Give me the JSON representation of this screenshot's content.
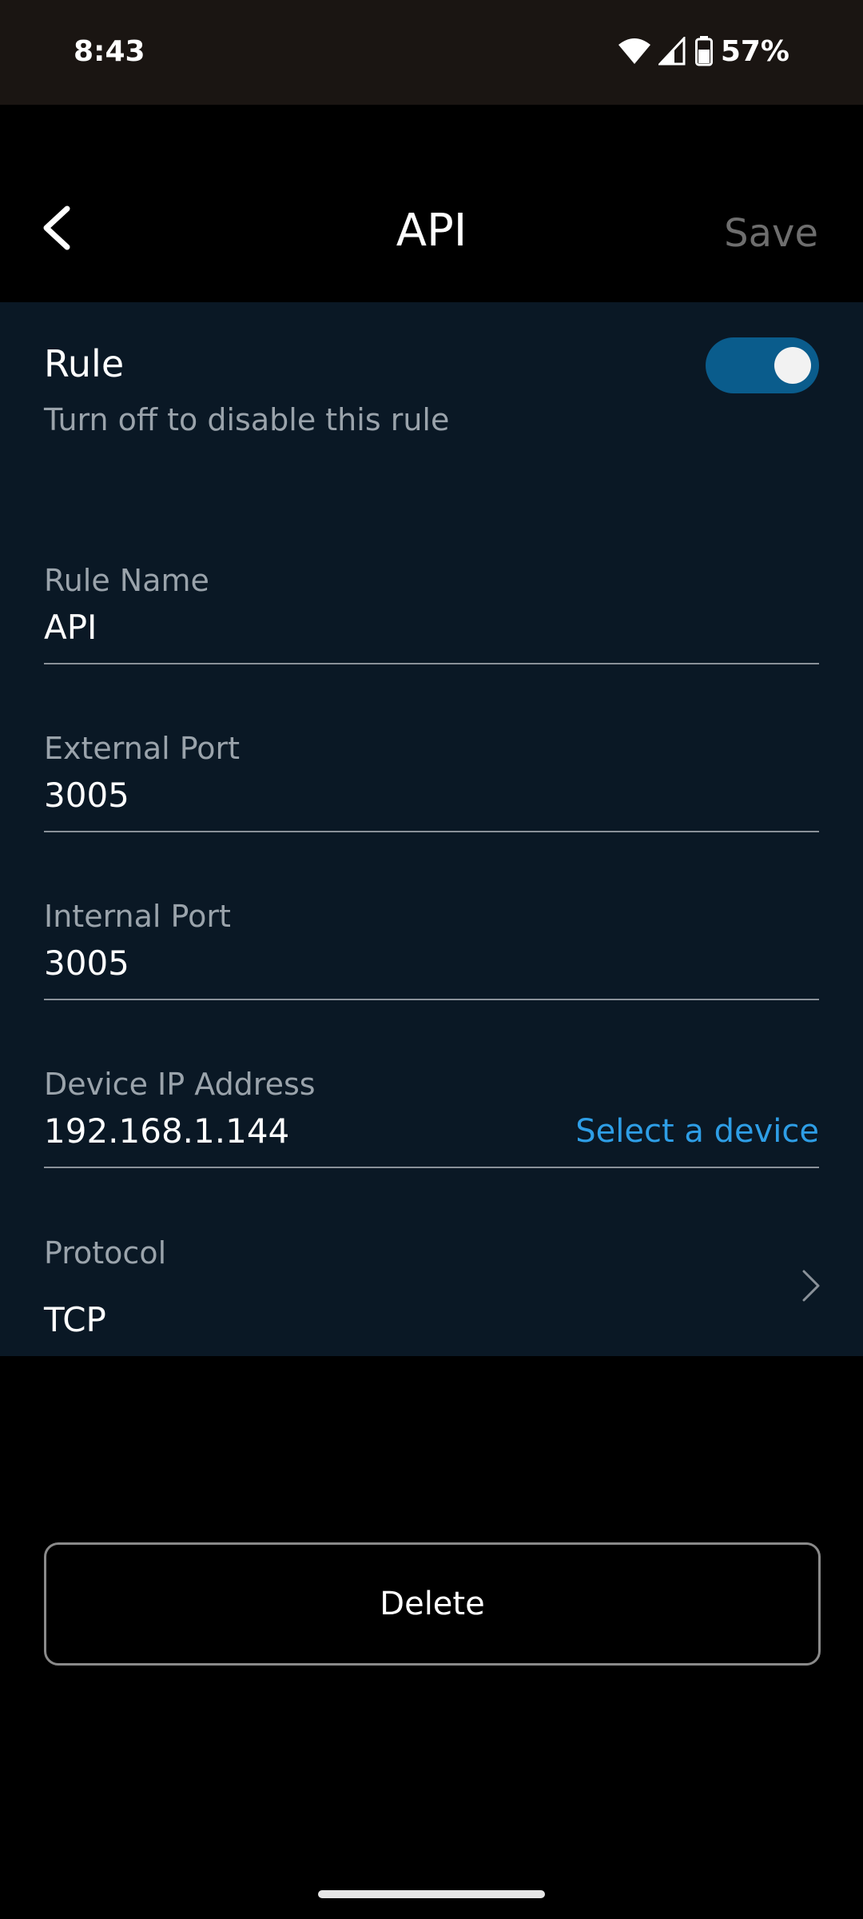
{
  "status_bar": {
    "time": "8:43",
    "battery": "57%",
    "icons": [
      "wifi-icon",
      "cell-signal-icon",
      "battery-icon"
    ]
  },
  "header": {
    "title": "API",
    "save_label": "Save",
    "back_icon": "chevron-left-icon"
  },
  "rule_toggle": {
    "title": "Rule",
    "subtitle": "Turn off to disable this rule",
    "enabled": true
  },
  "fields": {
    "rule_name": {
      "label": "Rule Name",
      "value": "API"
    },
    "external_port": {
      "label": "External Port",
      "value": "3005"
    },
    "internal_port": {
      "label": "Internal Port",
      "value": "3005"
    },
    "device_ip": {
      "label": "Device IP Address",
      "value": "192.168.1.144",
      "action_label": "Select a device"
    },
    "protocol": {
      "label": "Protocol",
      "value": "TCP"
    }
  },
  "delete_label": "Delete",
  "colors": {
    "accent": "#2e9ee6",
    "toggle_on": "#0a5c8c",
    "panel_bg": "#0a1825",
    "muted_text": "#9aa3ab"
  }
}
